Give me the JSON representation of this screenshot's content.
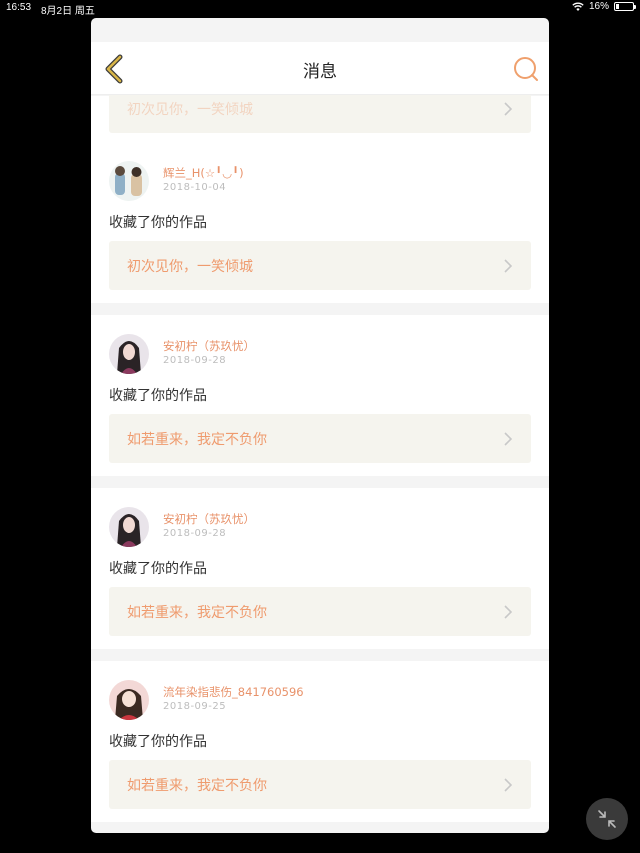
{
  "status_bar": {
    "time": "16:53",
    "date": "8月2日 周五",
    "battery_percent": "16%",
    "battery_level": 0.16
  },
  "nav": {
    "title": "消息"
  },
  "partial_card": {
    "work_title": "初次见你，一笑倾城"
  },
  "messages": [
    {
      "username": "辉兰_H(☆╹◡╹)",
      "date": "2018-10-04",
      "action": "收藏了你的作品",
      "work_title": "初次见你，一笑倾城"
    },
    {
      "username": "安初柠（苏玖忧）",
      "date": "2018-09-28",
      "action": "收藏了你的作品",
      "work_title": "如若重来，我定不负你"
    },
    {
      "username": "安初柠（苏玖忧）",
      "date": "2018-09-28",
      "action": "收藏了你的作品",
      "work_title": "如若重来，我定不负你"
    },
    {
      "username": "流年染指悲伤_841760596",
      "date": "2018-09-25",
      "action": "收藏了你的作品",
      "work_title": "如若重来，我定不负你"
    }
  ],
  "colors": {
    "accent": "#e8926a",
    "work_bg": "#f5f4ee",
    "back_icon": "#c9a03c"
  }
}
